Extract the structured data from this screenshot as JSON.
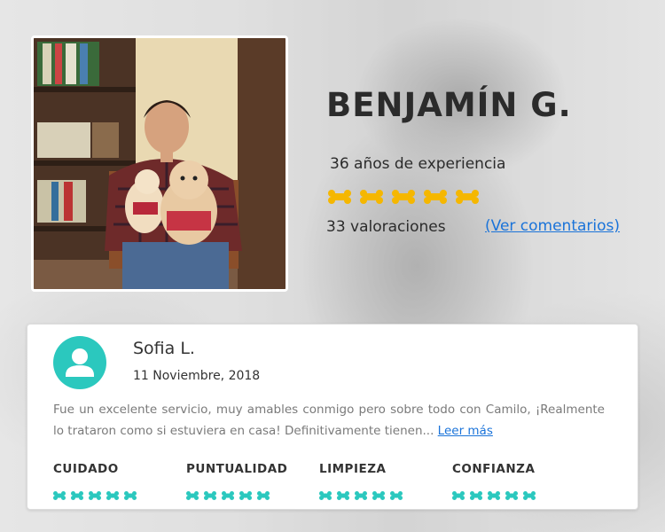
{
  "profile": {
    "name": "BENJAMÍN G.",
    "experience": "36 años de experiencia",
    "rating": 5,
    "reviews_count": "33 valoraciones",
    "view_comments": "(Ver comentarios)"
  },
  "review": {
    "reviewer": "Sofia L.",
    "date": "11 Noviembre, 2018",
    "text": "Fue un excelente servicio, muy amables conmigo pero sobre todo con Camilo, ¡Realmente lo trataron como si estuviera en casa! Definitivamente tienen...",
    "read_more": "Leer más",
    "categories": [
      {
        "label": "CUIDADO",
        "rating": 5
      },
      {
        "label": "PUNTUALIDAD",
        "rating": 5
      },
      {
        "label": "LIMPIEZA",
        "rating": 5
      },
      {
        "label": "CONFIANZA",
        "rating": 5
      }
    ]
  },
  "colors": {
    "gold": "#f5b700",
    "teal": "#2bc8be",
    "link": "#1a73d9"
  },
  "icons": {
    "rating_icon": "dog-bone-icon",
    "avatar_icon": "user-icon"
  }
}
